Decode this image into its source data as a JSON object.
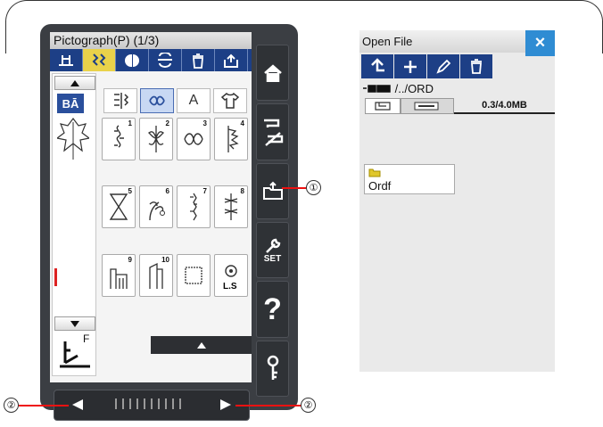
{
  "left_screen": {
    "title": "Pictograph(P) (1/3)",
    "toolbar": {
      "btn1": "foot-icon",
      "btn2": "twin-needle-icon",
      "btn3": "mirror-icon",
      "btn4": "flip-icon",
      "btn5": "delete-icon",
      "btn6": "save-icon"
    },
    "category_tabs": [
      "satin-stitch-icon",
      "decorative-leaf-icon",
      "A",
      "shirt-icon"
    ],
    "selected_tab": "decorative-leaf-icon",
    "pattern_numbers": [
      "1",
      "2",
      "3",
      "4",
      "5",
      "6",
      "7",
      "8",
      "9",
      "10",
      "",
      ""
    ],
    "last_cell_label": "L.S",
    "presser_foot": "F",
    "memory_label": "BĀ"
  },
  "right_bar": {
    "home": "home-icon",
    "mode_switch": "sewing-mode-icon",
    "open_file": "open-file-icon",
    "settings_label": "SET",
    "help_label": "?",
    "lock": "key-icon"
  },
  "open_file": {
    "title": "Open File",
    "close": "×",
    "path": "/../ORD",
    "storage": "0.3/4.0MB",
    "folder_name": "Ordf"
  },
  "callouts": {
    "c1": "①",
    "c2": "②",
    "c3": "②"
  }
}
